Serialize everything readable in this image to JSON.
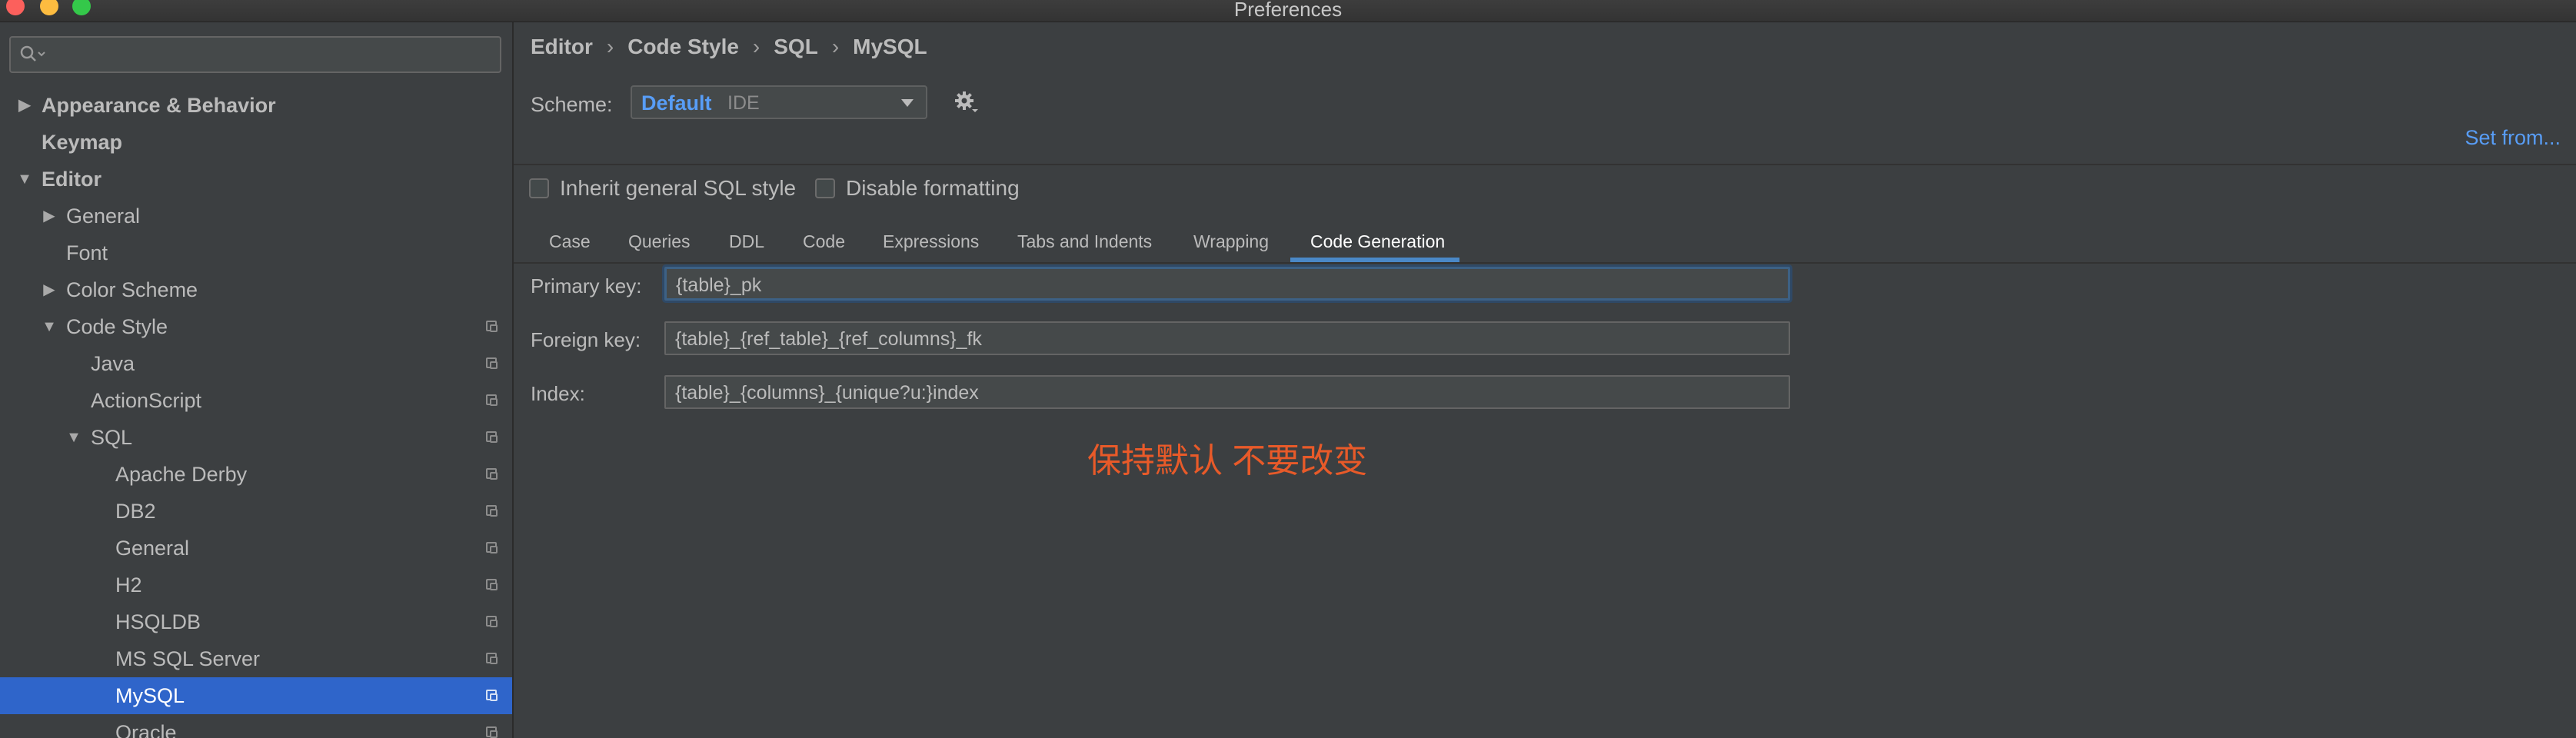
{
  "window": {
    "title": "Preferences"
  },
  "sidebar": {
    "search_placeholder": "",
    "items": [
      {
        "label": "Appearance & Behavior",
        "indent": 0,
        "arrow": "right",
        "bold": true,
        "copy": false,
        "selected": false
      },
      {
        "label": "Keymap",
        "indent": 0,
        "arrow": "",
        "bold": true,
        "copy": false,
        "selected": false
      },
      {
        "label": "Editor",
        "indent": 0,
        "arrow": "down",
        "bold": true,
        "copy": false,
        "selected": false
      },
      {
        "label": "General",
        "indent": 1,
        "arrow": "right",
        "bold": false,
        "copy": false,
        "selected": false
      },
      {
        "label": "Font",
        "indent": 1,
        "arrow": "",
        "bold": false,
        "copy": false,
        "selected": false
      },
      {
        "label": "Color Scheme",
        "indent": 1,
        "arrow": "right",
        "bold": false,
        "copy": false,
        "selected": false
      },
      {
        "label": "Code Style",
        "indent": 1,
        "arrow": "down",
        "bold": false,
        "copy": true,
        "selected": false
      },
      {
        "label": "Java",
        "indent": 2,
        "arrow": "",
        "bold": false,
        "copy": true,
        "selected": false
      },
      {
        "label": "ActionScript",
        "indent": 2,
        "arrow": "",
        "bold": false,
        "copy": true,
        "selected": false
      },
      {
        "label": "SQL",
        "indent": 2,
        "arrow": "down",
        "bold": false,
        "copy": true,
        "selected": false
      },
      {
        "label": "Apache Derby",
        "indent": 3,
        "arrow": "",
        "bold": false,
        "copy": true,
        "selected": false
      },
      {
        "label": "DB2",
        "indent": 3,
        "arrow": "",
        "bold": false,
        "copy": true,
        "selected": false
      },
      {
        "label": "General",
        "indent": 3,
        "arrow": "",
        "bold": false,
        "copy": true,
        "selected": false
      },
      {
        "label": "H2",
        "indent": 3,
        "arrow": "",
        "bold": false,
        "copy": true,
        "selected": false
      },
      {
        "label": "HSQLDB",
        "indent": 3,
        "arrow": "",
        "bold": false,
        "copy": true,
        "selected": false
      },
      {
        "label": "MS SQL Server",
        "indent": 3,
        "arrow": "",
        "bold": false,
        "copy": true,
        "selected": false
      },
      {
        "label": "MySQL",
        "indent": 3,
        "arrow": "",
        "bold": false,
        "copy": true,
        "selected": true
      },
      {
        "label": "Oracle",
        "indent": 3,
        "arrow": "",
        "bold": false,
        "copy": true,
        "selected": false
      }
    ]
  },
  "breadcrumb": [
    "Editor",
    "Code Style",
    "SQL",
    "MySQL"
  ],
  "breadcrumb_sep": "›",
  "scheme": {
    "label": "Scheme:",
    "value": "Default",
    "sub": "IDE",
    "set_from": "Set from..."
  },
  "checkboxes": [
    {
      "label": "Inherit general SQL style",
      "checked": false
    },
    {
      "label": "Disable formatting",
      "checked": false
    }
  ],
  "tabs": [
    "Case",
    "Queries",
    "DDL",
    "Code",
    "Expressions",
    "Tabs and Indents",
    "Wrapping",
    "Code Generation"
  ],
  "active_tab": "Code Generation",
  "form": [
    {
      "label": "Primary key:",
      "value": "{table}_pk",
      "focused": true
    },
    {
      "label": "Foreign key:",
      "value": "{table}_{ref_table}_{ref_columns}_fk",
      "focused": false
    },
    {
      "label": "Index:",
      "value": "{table}_{columns}_{unique?u:}index",
      "focused": false
    }
  ],
  "annotation": "保持默认 不要改变",
  "colors": {
    "accent": "#589df6",
    "selection": "#2f65ca",
    "annotation": "#e85a29"
  }
}
